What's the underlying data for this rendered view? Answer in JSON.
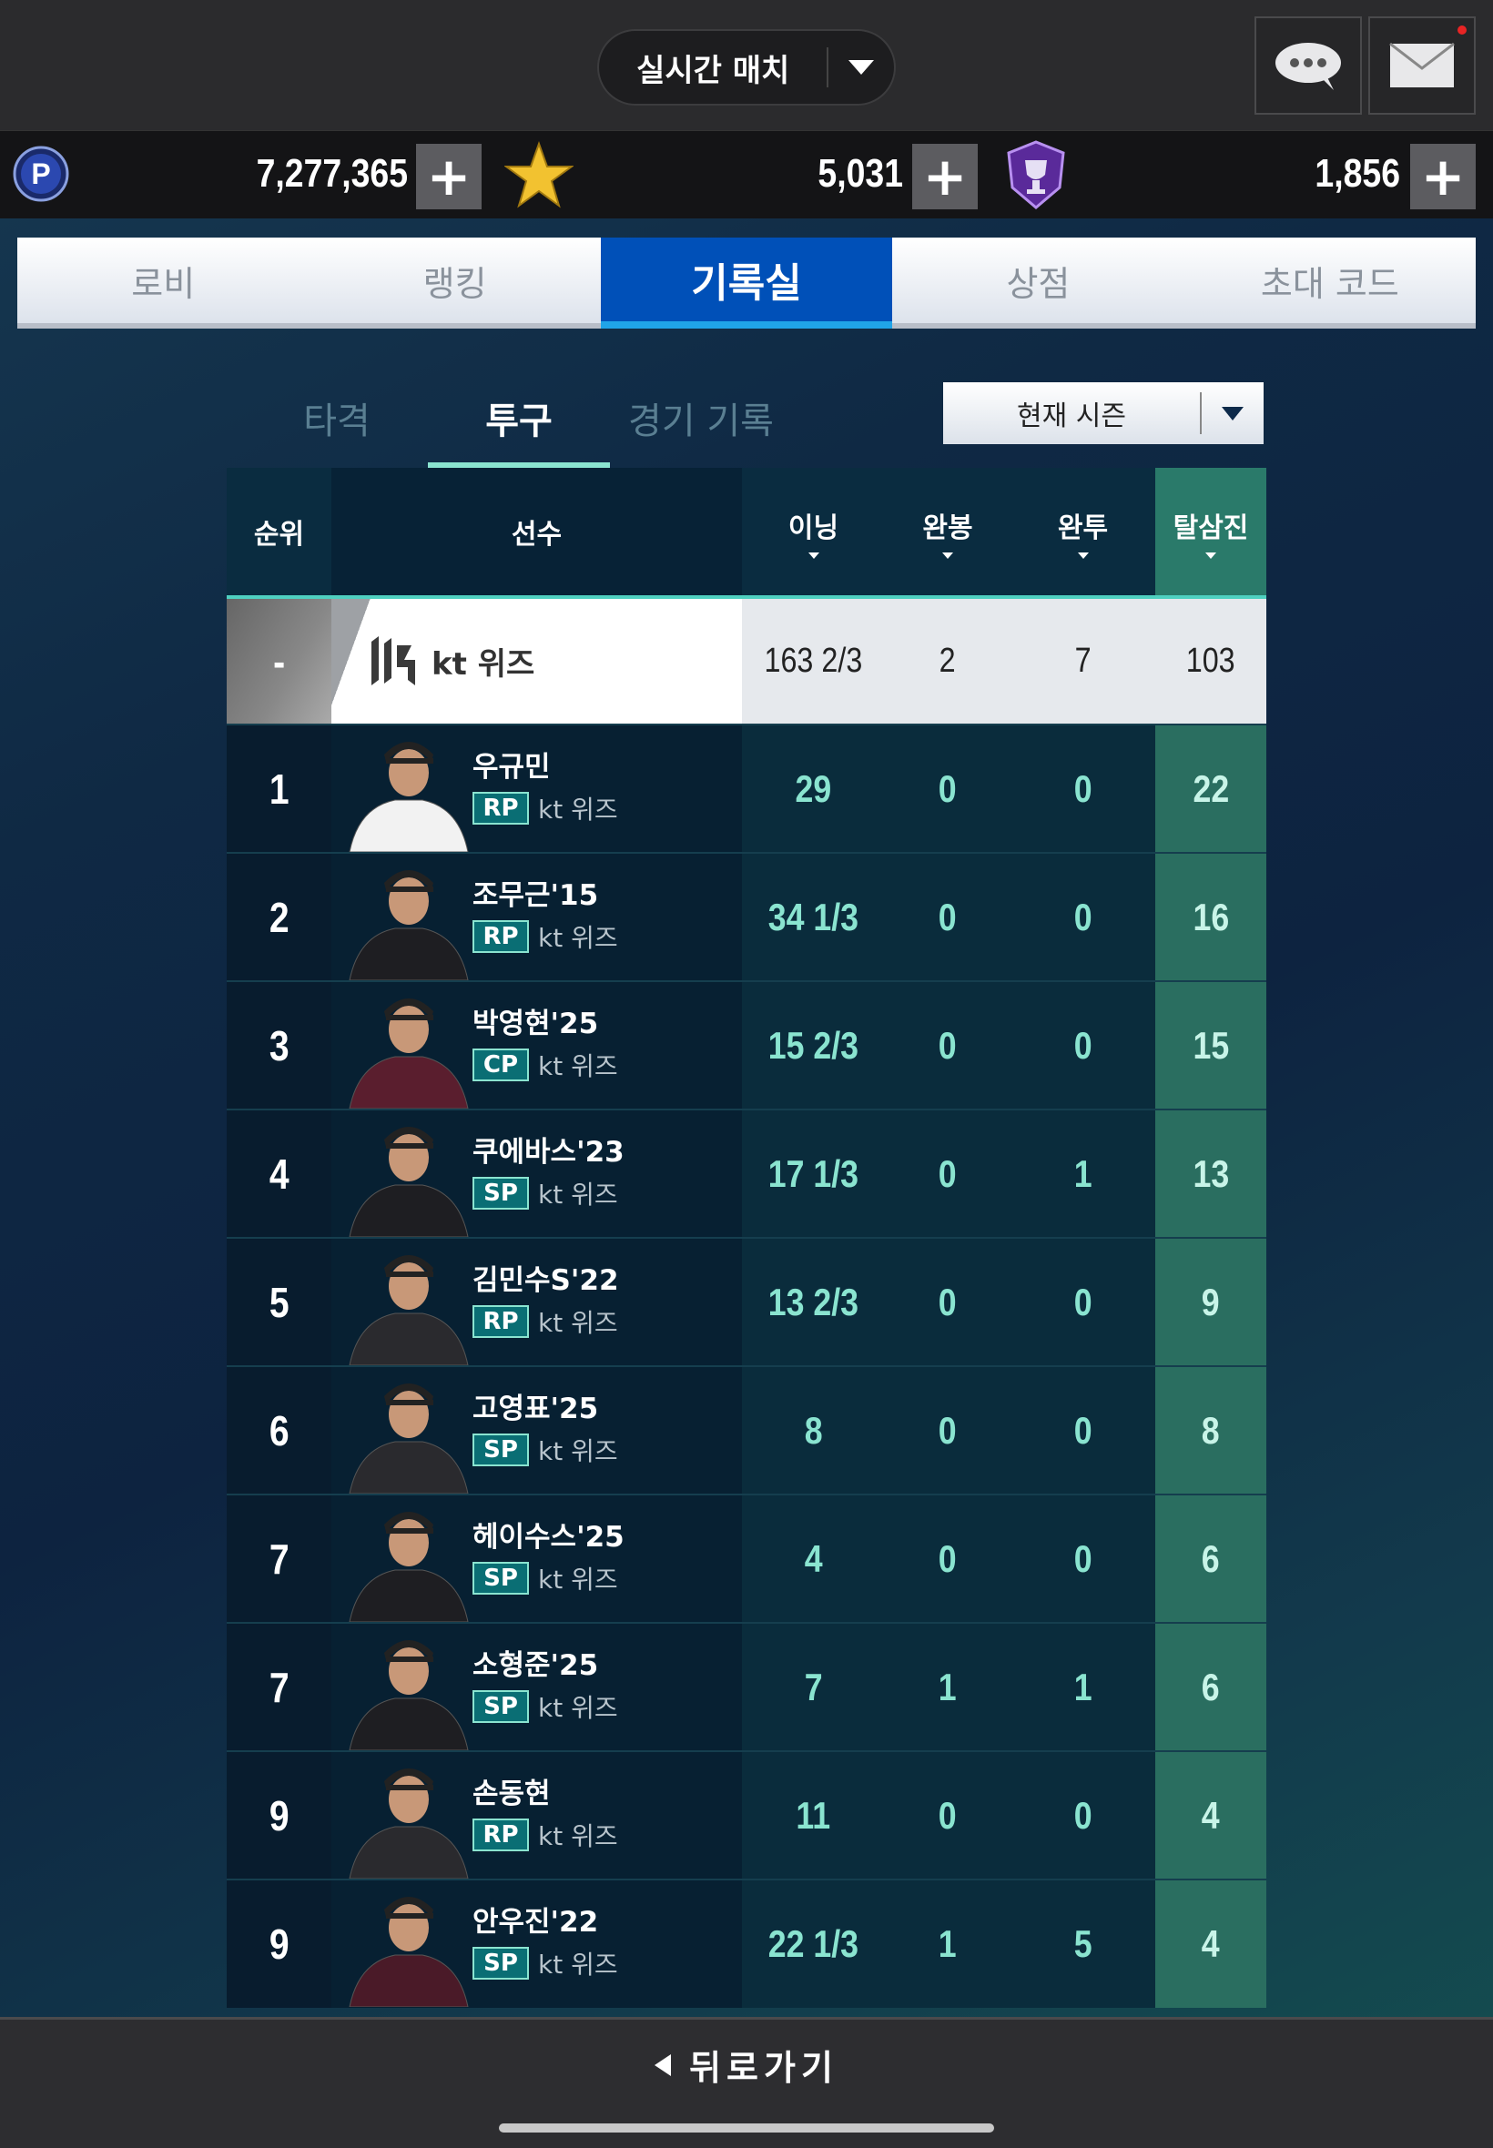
{
  "header": {
    "mode_label": "실시간 매치",
    "chat_icon": "chat-bubble-icon",
    "mail_icon": "envelope-icon",
    "mail_badge_color": "#e82424"
  },
  "currencies": [
    {
      "icon": "p-coin-icon",
      "value": "7,277,365"
    },
    {
      "icon": "star-icon",
      "value": "5,031"
    },
    {
      "icon": "trophy-shield-icon",
      "value": "1,856"
    }
  ],
  "plus_label": "+",
  "tabs": [
    "로비",
    "랭킹",
    "기록실",
    "상점",
    "초대 코드"
  ],
  "active_tab": 2,
  "subtabs": [
    "타격",
    "투구",
    "경기 기록"
  ],
  "active_subtab": 1,
  "season": {
    "selected": "현재 시즌"
  },
  "table": {
    "headers": {
      "rank": "순위",
      "player": "선수",
      "innings": "이닝",
      "shutouts": "완봉",
      "complete_games": "완투",
      "strikeouts": "탈삼진"
    },
    "team_row": {
      "rank": "-",
      "team": "kt 위즈",
      "innings": "163 2/3",
      "shutouts": "2",
      "complete_games": "7",
      "strikeouts": "103"
    },
    "rows": [
      {
        "rank": "1",
        "name": "우규민",
        "pos": "RP",
        "team": "kt 위즈",
        "innings": "29",
        "shutouts": "0",
        "complete_games": "0",
        "strikeouts": "22"
      },
      {
        "rank": "2",
        "name": "조무근'15",
        "pos": "RP",
        "team": "kt 위즈",
        "innings": "34 1/3",
        "shutouts": "0",
        "complete_games": "0",
        "strikeouts": "16"
      },
      {
        "rank": "3",
        "name": "박영현'25",
        "pos": "CP",
        "team": "kt 위즈",
        "innings": "15 2/3",
        "shutouts": "0",
        "complete_games": "0",
        "strikeouts": "15"
      },
      {
        "rank": "4",
        "name": "쿠에바스'23",
        "pos": "SP",
        "team": "kt 위즈",
        "innings": "17 1/3",
        "shutouts": "0",
        "complete_games": "1",
        "strikeouts": "13"
      },
      {
        "rank": "5",
        "name": "김민수S'22",
        "pos": "RP",
        "team": "kt 위즈",
        "innings": "13 2/3",
        "shutouts": "0",
        "complete_games": "0",
        "strikeouts": "9"
      },
      {
        "rank": "6",
        "name": "고영표'25",
        "pos": "SP",
        "team": "kt 위즈",
        "innings": "8",
        "shutouts": "0",
        "complete_games": "0",
        "strikeouts": "8"
      },
      {
        "rank": "7",
        "name": "헤이수스'25",
        "pos": "SP",
        "team": "kt 위즈",
        "innings": "4",
        "shutouts": "0",
        "complete_games": "0",
        "strikeouts": "6"
      },
      {
        "rank": "7",
        "name": "소형준'25",
        "pos": "SP",
        "team": "kt 위즈",
        "innings": "7",
        "shutouts": "1",
        "complete_games": "1",
        "strikeouts": "6"
      },
      {
        "rank": "9",
        "name": "손동현",
        "pos": "RP",
        "team": "kt 위즈",
        "innings": "11",
        "shutouts": "0",
        "complete_games": "0",
        "strikeouts": "4"
      },
      {
        "rank": "9",
        "name": "안우진'22",
        "pos": "SP",
        "team": "kt 위즈",
        "innings": "22 1/3",
        "shutouts": "1",
        "complete_games": "5",
        "strikeouts": "4"
      }
    ]
  },
  "footer": {
    "back_label": "뒤로가기"
  },
  "colors": {
    "accent_teal": "#8ae4d0",
    "active_tab": "#0050b8",
    "sorted_column": "#2a7a6a"
  }
}
